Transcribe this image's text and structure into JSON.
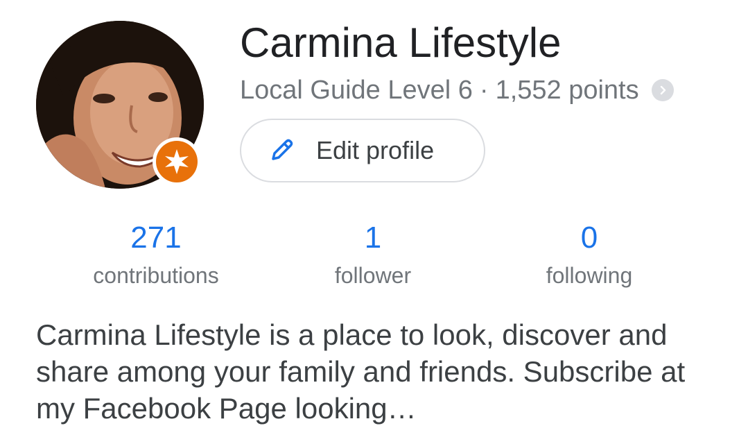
{
  "profile": {
    "name": "Carmina Lifestyle",
    "level_text": "Local Guide Level 6",
    "separator": "·",
    "points_text": "1,552 points",
    "badge_color": "#e8710a"
  },
  "actions": {
    "edit_profile_label": "Edit profile"
  },
  "stats": [
    {
      "value": "271",
      "label": "contributions"
    },
    {
      "value": "1",
      "label": "follower"
    },
    {
      "value": "0",
      "label": "following"
    }
  ],
  "bio": {
    "text": "Carmina Lifestyle is a place to look, discover and share among your family and friends. Subscribe at my Facebook Page looking…"
  },
  "icons": {
    "edit": "pencil-icon",
    "more": "chevron-right-icon",
    "badge": "local-guide-star-icon"
  },
  "colors": {
    "accent_blue": "#1a73e8",
    "secondary_text": "#70757a",
    "badge_orange": "#e8710a"
  }
}
